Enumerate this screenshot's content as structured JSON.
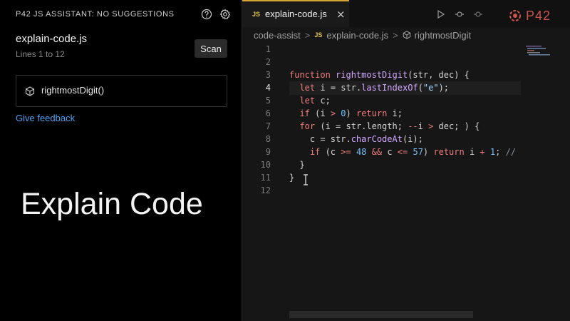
{
  "left_panel": {
    "title": "P42 JS ASSISTANT: NO SUGGESTIONS",
    "file_name": "explain-code.js",
    "lines": "Lines 1 to 12",
    "scan_label": "Scan",
    "function_item": "rightmostDigit()",
    "feedback_label": "Give feedback",
    "overlay_caption": "Explain Code"
  },
  "editor": {
    "tab_label": "explain-code.js",
    "tab_badge": "JS",
    "close_glyph": "×",
    "breadcrumb": {
      "root": "code-assist",
      "file": "explain-code.js",
      "badge": "JS",
      "symbol": "rightmostDigit",
      "sep": ">"
    },
    "brand_text": "P42",
    "active_line": 4,
    "line_numbers": [
      "1",
      "2",
      "3",
      "4",
      "5",
      "6",
      "7",
      "8",
      "9",
      "10",
      "11",
      "12"
    ]
  },
  "colors": {
    "accent_tab": "#d6a534",
    "link": "#4aa3f2",
    "keyword": "#f07d7d",
    "function": "#d2a8ff",
    "string": "#a5d6ff",
    "brand": "#c9544d"
  },
  "icons": [
    "help-icon",
    "gear-icon",
    "cube-icon",
    "run-icon",
    "split-icon",
    "circle-icon",
    "cursor-icon",
    "p42-logo"
  ]
}
